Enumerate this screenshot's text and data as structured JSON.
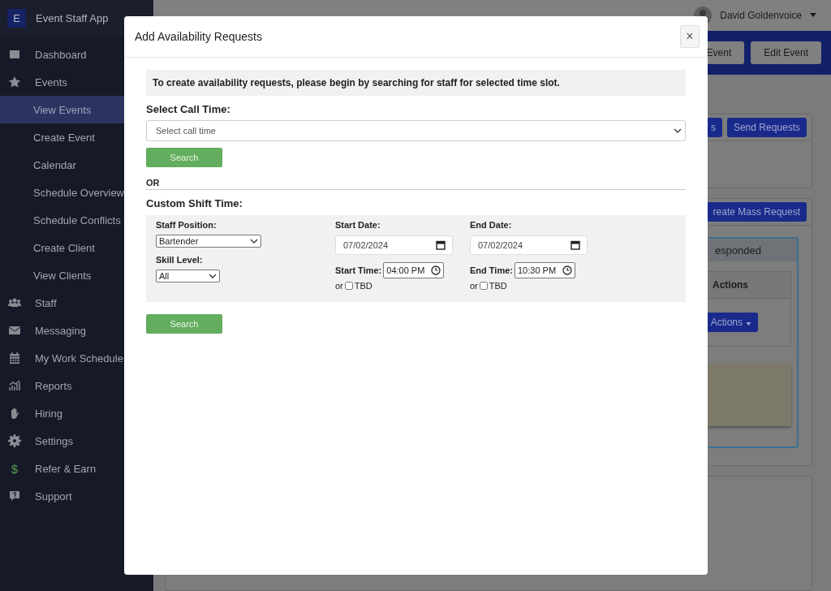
{
  "sidebar": {
    "logo": "E",
    "app_name": "Event Staff App",
    "items": [
      {
        "label": "Dashboard",
        "selected": false
      },
      {
        "label": "Events",
        "selected": false,
        "expanded": true,
        "children": [
          {
            "label": "View Events",
            "selected": true
          },
          {
            "label": "Create Event",
            "selected": false
          },
          {
            "label": "Calendar",
            "selected": false
          },
          {
            "label": "Schedule Overview",
            "selected": false
          },
          {
            "label": "Schedule Conflicts",
            "selected": false
          },
          {
            "label": "Create Client",
            "selected": false
          },
          {
            "label": "View Clients",
            "selected": false
          }
        ]
      },
      {
        "label": "Staff",
        "selected": false
      },
      {
        "label": "Messaging",
        "selected": false
      },
      {
        "label": "My Work Schedule",
        "selected": false
      },
      {
        "label": "Reports",
        "selected": false
      },
      {
        "label": "Hiring",
        "selected": false
      },
      {
        "label": "Settings",
        "selected": false
      },
      {
        "label": "Refer & Earn",
        "selected": false,
        "icon_text": "$"
      },
      {
        "label": "Support",
        "selected": false
      }
    ]
  },
  "header": {
    "user_name": "David Goldenvoice",
    "buttons": [
      "Event",
      "Edit Event"
    ]
  },
  "background": {
    "panel_buttons": [
      "s",
      "Send Requests"
    ],
    "mass_request_button": "reate Mass Request",
    "box_title": "esponded",
    "table_column": "Actions",
    "row_button": "Actions"
  },
  "modal": {
    "title": "Add Availability Requests",
    "close": "×",
    "notice": "To create availability requests, please begin by searching for staff for selected time slot.",
    "call_time": {
      "label": "Select Call Time:",
      "placeholder": "Select call time"
    },
    "search_button": "Search",
    "or_text": "OR",
    "custom_label": "Custom Shift Time:",
    "staff_position": {
      "label": "Staff Position:",
      "value": "Bartender"
    },
    "skill_level": {
      "label": "Skill Level:",
      "value": "All"
    },
    "start_date": {
      "label": "Start Date:",
      "value": "07/02/2024"
    },
    "end_date": {
      "label": "End Date:",
      "value": "07/02/2024"
    },
    "start_time": {
      "label": "Start Time:",
      "value": "04:00 PM",
      "or_text": "or",
      "tbd_label": "TBD",
      "tbd_checked": false
    },
    "end_time": {
      "label": "End Time:",
      "value": "10:30 PM",
      "or_text": "or",
      "tbd_label": "TBD",
      "tbd_checked": false
    },
    "search_button_2": "Search"
  }
}
